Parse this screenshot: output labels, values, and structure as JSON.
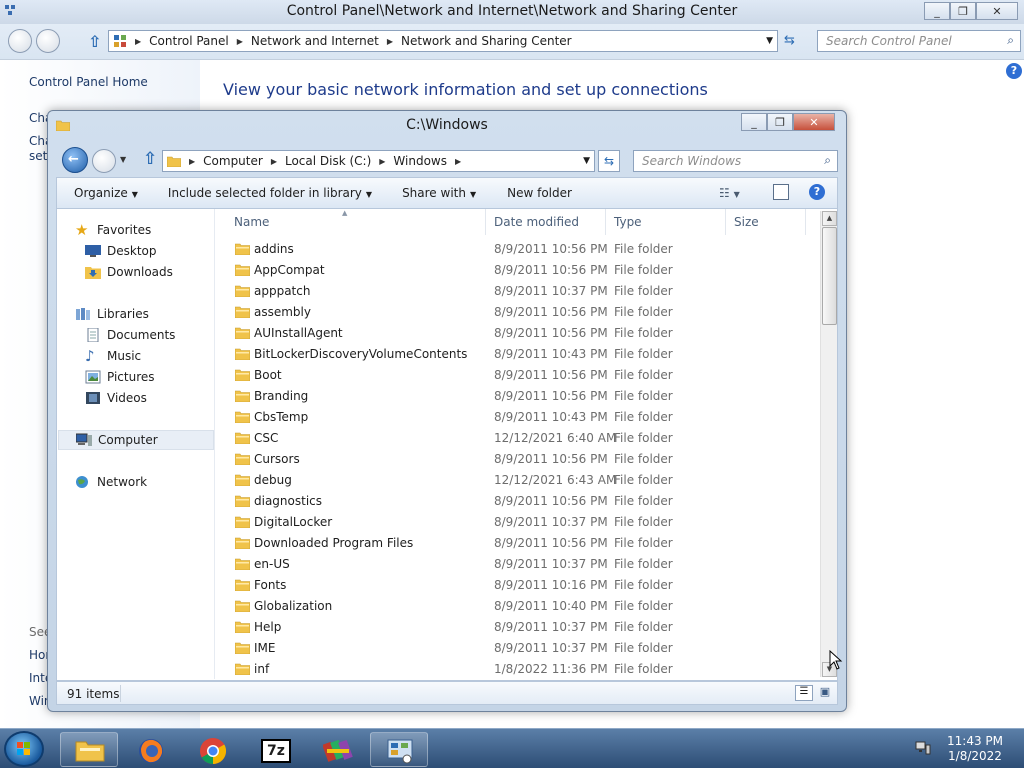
{
  "control_panel": {
    "title": "Control Panel\\Network and Internet\\Network and Sharing Center",
    "breadcrumbs": [
      "Control Panel",
      "Network and Internet",
      "Network and Sharing Center"
    ],
    "search_placeholder": "Search Control Panel",
    "left_links": [
      "Control Panel Home",
      "Cha",
      "Cha",
      "sett",
      "See",
      "Hor",
      "Inte",
      "Win"
    ],
    "heading": "View your basic network information and set up connections"
  },
  "explorer": {
    "title": "C:\\Windows",
    "breadcrumbs": [
      "Computer",
      "Local Disk (C:)",
      "Windows"
    ],
    "search_placeholder": "Search Windows",
    "toolbar": {
      "organize": "Organize",
      "include": "Include selected folder in library",
      "share": "Share with",
      "new_folder": "New folder"
    },
    "nav": {
      "favorites": "Favorites",
      "desktop": "Desktop",
      "downloads": "Downloads",
      "libraries": "Libraries",
      "documents": "Documents",
      "music": "Music",
      "pictures": "Pictures",
      "videos": "Videos",
      "computer": "Computer",
      "network": "Network"
    },
    "columns": {
      "name": "Name",
      "date": "Date modified",
      "type": "Type",
      "size": "Size"
    },
    "files": [
      {
        "name": "addins",
        "date": "8/9/2011 10:56 PM",
        "type": "File folder"
      },
      {
        "name": "AppCompat",
        "date": "8/9/2011 10:56 PM",
        "type": "File folder"
      },
      {
        "name": "apppatch",
        "date": "8/9/2011 10:37 PM",
        "type": "File folder"
      },
      {
        "name": "assembly",
        "date": "8/9/2011 10:56 PM",
        "type": "File folder"
      },
      {
        "name": "AUInstallAgent",
        "date": "8/9/2011 10:56 PM",
        "type": "File folder"
      },
      {
        "name": "BitLockerDiscoveryVolumeContents",
        "date": "8/9/2011 10:43 PM",
        "type": "File folder"
      },
      {
        "name": "Boot",
        "date": "8/9/2011 10:56 PM",
        "type": "File folder"
      },
      {
        "name": "Branding",
        "date": "8/9/2011 10:56 PM",
        "type": "File folder"
      },
      {
        "name": "CbsTemp",
        "date": "8/9/2011 10:43 PM",
        "type": "File folder"
      },
      {
        "name": "CSC",
        "date": "12/12/2021 6:40 AM",
        "type": "File folder"
      },
      {
        "name": "Cursors",
        "date": "8/9/2011 10:56 PM",
        "type": "File folder"
      },
      {
        "name": "debug",
        "date": "12/12/2021 6:43 AM",
        "type": "File folder"
      },
      {
        "name": "diagnostics",
        "date": "8/9/2011 10:56 PM",
        "type": "File folder"
      },
      {
        "name": "DigitalLocker",
        "date": "8/9/2011 10:37 PM",
        "type": "File folder"
      },
      {
        "name": "Downloaded Program Files",
        "date": "8/9/2011 10:56 PM",
        "type": "File folder"
      },
      {
        "name": "en-US",
        "date": "8/9/2011 10:37 PM",
        "type": "File folder"
      },
      {
        "name": "Fonts",
        "date": "8/9/2011 10:16 PM",
        "type": "File folder"
      },
      {
        "name": "Globalization",
        "date": "8/9/2011 10:40 PM",
        "type": "File folder"
      },
      {
        "name": "Help",
        "date": "8/9/2011 10:37 PM",
        "type": "File folder"
      },
      {
        "name": "IME",
        "date": "8/9/2011 10:37 PM",
        "type": "File folder"
      },
      {
        "name": "inf",
        "date": "1/8/2022 11:36 PM",
        "type": "File folder"
      }
    ],
    "status": "91 items"
  },
  "taskbar": {
    "items": [
      "folder-icon",
      "firefox-icon",
      "chrome-icon",
      "7zip-icon",
      "winrar-icon",
      "control-panel-icon"
    ],
    "time": "11:43 PM",
    "date": "1/8/2022"
  },
  "colors": {
    "folder": "#f2c94c",
    "link": "#1e3b8b",
    "taskbar": "#2d4d75"
  }
}
